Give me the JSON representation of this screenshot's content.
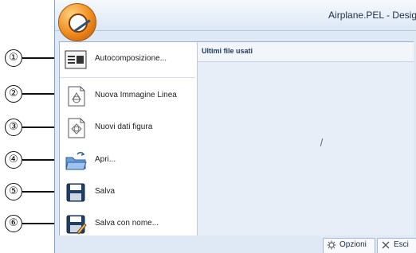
{
  "window": {
    "title": "Airplane.PEL - Desig"
  },
  "menu": {
    "items": [
      {
        "callout": "①",
        "label": "Autocomposizione...",
        "icon": "autocomposition-icon"
      },
      {
        "callout": "②",
        "label": "Nuova Immagine Linea",
        "icon": "new-line-image-icon"
      },
      {
        "callout": "③",
        "label": "Nuovi dati figura",
        "icon": "new-figure-data-icon"
      },
      {
        "callout": "④",
        "label": "Apri...",
        "icon": "open-folder-icon"
      },
      {
        "callout": "⑤",
        "label": "Salva",
        "icon": "save-icon"
      },
      {
        "callout": "⑥",
        "label": "Salva con nome...",
        "icon": "save-as-icon"
      }
    ],
    "recent_title": "Ultimi file usati"
  },
  "footer": {
    "options_label": "Opzioni",
    "exit_label": "Esci"
  }
}
